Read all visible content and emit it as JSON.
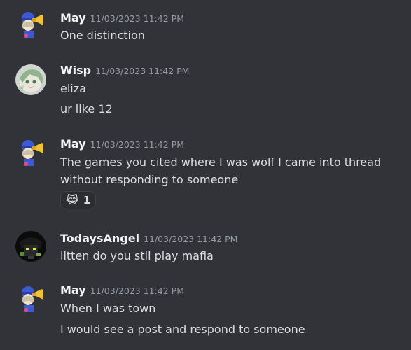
{
  "messages": [
    {
      "author": "May",
      "timestamp": "11/03/2023 11:42 PM",
      "avatar": "may-avatar",
      "lines": [
        "One distinction"
      ]
    },
    {
      "author": "Wisp",
      "timestamp": "11/03/2023 11:42 PM",
      "avatar": "wisp-avatar",
      "lines": [
        "eliza",
        "ur like 12"
      ]
    },
    {
      "author": "May",
      "timestamp": "11/03/2023 11:42 PM",
      "avatar": "may-avatar",
      "lines": [
        "The games you cited where I was wolf I came into thread",
        "without responding to someone"
      ],
      "reaction": {
        "emoji": "😹",
        "count": "1"
      }
    },
    {
      "author": "TodaysAngel",
      "timestamp": "11/03/2023 11:42 PM",
      "avatar": "todaysangel-avatar",
      "lines": [
        "litten do you stil play mafia"
      ]
    },
    {
      "author": "May",
      "timestamp": "11/03/2023 11:42 PM",
      "avatar": "may-avatar",
      "lines": [
        "When I was town",
        "I would see a post and respond to someone"
      ]
    }
  ],
  "colors": {
    "background": "#313338",
    "author": "#f2f3f5",
    "text": "#dbdee1",
    "timestamp": "#949ba4"
  }
}
